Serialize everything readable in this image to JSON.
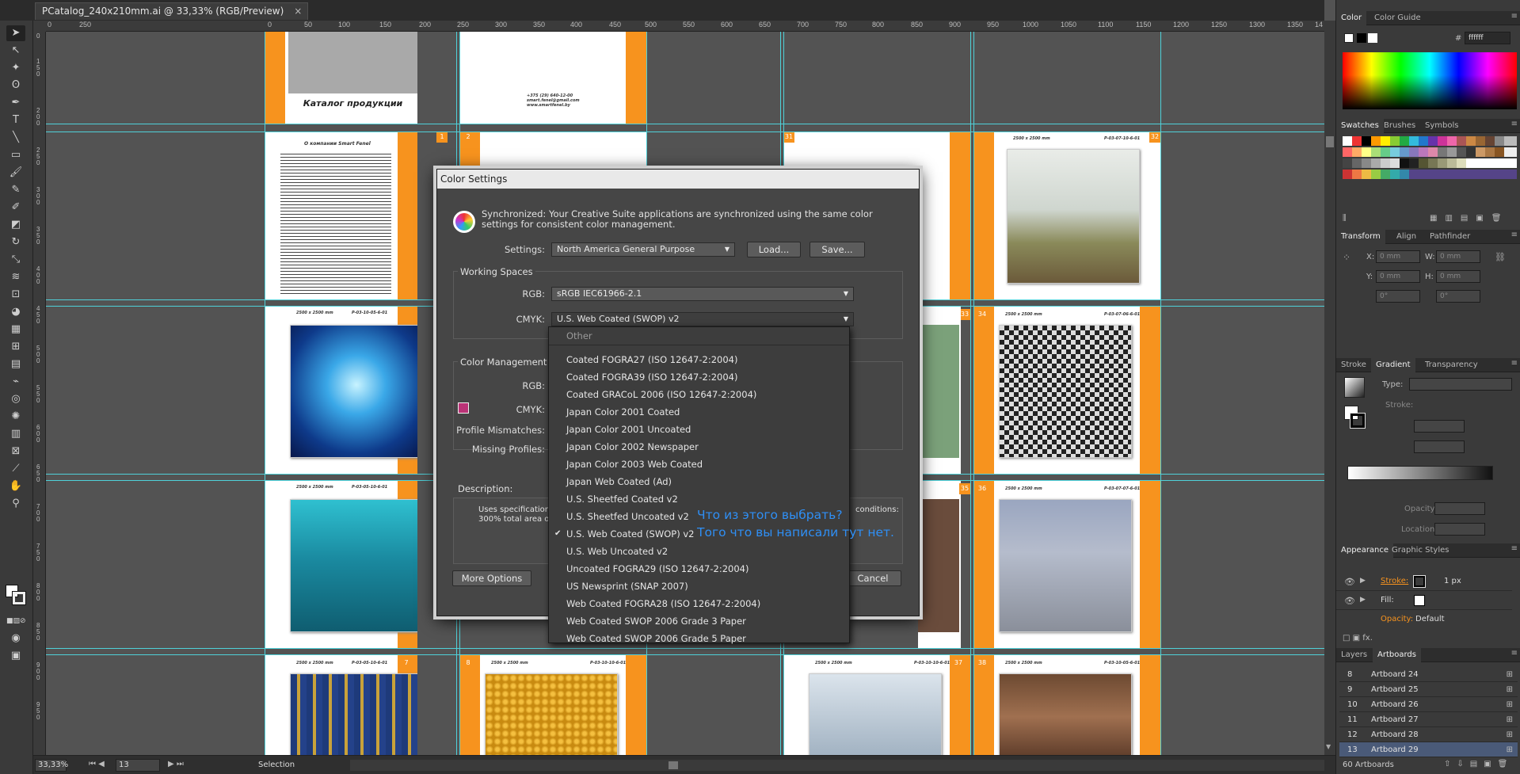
{
  "document": {
    "tab_title": "PCatalog_240x210mm.ai @ 33,33% (RGB/Preview)",
    "close_glyph": "×"
  },
  "ruler": {
    "top_ticks": [
      "0",
      "250",
      "0",
      "50",
      "100",
      "150",
      "200",
      "250",
      "300",
      "350",
      "400",
      "450",
      "500",
      "550",
      "600",
      "650",
      "700",
      "750",
      "800",
      "850",
      "900",
      "950",
      "1000",
      "1050",
      "1100",
      "1150",
      "1200",
      "1250",
      "1300",
      "1350",
      "14"
    ],
    "left_ticks": [
      "0",
      "150",
      "200",
      "250",
      "300",
      "350",
      "400",
      "450",
      "500",
      "550",
      "600",
      "650",
      "700",
      "750",
      "800",
      "850",
      "900",
      "950"
    ]
  },
  "artboards": {
    "catalog_title": "Каталог продукции",
    "contact_lines": [
      "+375 (29) 640-12-00",
      "smart.fenel@gmail.com",
      "www.smartfenel.by"
    ],
    "about_title": "О компании Smart Fenel",
    "page_numbers": [
      "1",
      "2",
      "31",
      "32",
      "33",
      "34",
      "35",
      "36",
      "7",
      "8",
      "37",
      "38"
    ],
    "size_captions": [
      "2500 x 2500 mm",
      "P-03-07-10-6-01",
      "2500 x 2500 mm",
      "P-03-10-05-6-01",
      "2500 x 2500 mm",
      "P-03-07-06-6-01",
      "2500 x 2500 mm",
      "P-03-05-10-6-01",
      "2500 x 2500 mm",
      "P-03-07-07-6-01",
      "2500 x 2500 mm",
      "P-03-05-10-6-01",
      "2500 x 2500 mm",
      "P-03-10-10-6-01",
      "2500 x 2500 mm",
      "P-03-10-10-6-01",
      "2500 x 2500 mm",
      "P-03-10-05-6-01",
      "2500 x 2500 mm",
      "P-03-10-05-6-01"
    ]
  },
  "statusbar": {
    "zoom": "33,33%",
    "artboard_num": "13",
    "tool": "Selection"
  },
  "dialog": {
    "title": "Color Settings",
    "sync_text": "Synchronized: Your Creative Suite applications are synchronized using the same color settings for consistent color management.",
    "settings_label": "Settings:",
    "settings_value": "North America General Purpose",
    "load_button": "Load...",
    "save_button": "Save...",
    "working_spaces": "Working Spaces",
    "rgb_label": "RGB:",
    "rgb_value": "sRGB IEC61966-2.1",
    "cmyk_label": "CMYK:",
    "cmyk_value": "U.S. Web Coated (SWOP) v2",
    "cmp_group": "Color Management P",
    "cmp_rgb_label": "RGB:",
    "cmp_cmyk_label": "CMYK:",
    "profile_mismatches": "Profile Mismatches:",
    "missing_profiles": "Missing Profiles:",
    "description_label": "Description:",
    "description_text_1": "Uses specifications",
    "description_text_2": "300% total area of i",
    "description_right": "conditions:",
    "more_options": "More Options",
    "cancel_button": "Cancel"
  },
  "dropdown": {
    "header": "Other",
    "items": [
      "Coated FOGRA27 (ISO 12647-2:2004)",
      "Coated FOGRA39 (ISO 12647-2:2004)",
      "Coated GRACoL 2006 (ISO 12647-2:2004)",
      "Japan Color 2001 Coated",
      "Japan Color 2001 Uncoated",
      "Japan Color 2002 Newspaper",
      "Japan Color 2003 Web Coated",
      "Japan Web Coated (Ad)",
      "U.S. Sheetfed Coated v2",
      "U.S. Sheetfed Uncoated v2",
      "U.S. Web Coated (SWOP) v2",
      "U.S. Web Uncoated v2",
      "Uncoated FOGRA29 (ISO 12647-2:2004)",
      "US Newsprint (SNAP 2007)",
      "Web Coated FOGRA28 (ISO 12647-2:2004)",
      "Web Coated SWOP 2006 Grade 3 Paper",
      "Web Coated SWOP 2006 Grade 5 Paper"
    ],
    "checked_index": 10,
    "check_glyph": "✔"
  },
  "overlay_text": {
    "line1": "Что из этого выбрать?",
    "line2": "Того что вы написали тут нет."
  },
  "panels": {
    "color_tabs": [
      "Color",
      "Color Guide"
    ],
    "hex_symbol": "#",
    "hex_value": "ffffff",
    "swatch_tabs": [
      "Swatches",
      "Brushes",
      "Symbols"
    ],
    "transform_tabs": [
      "Transform",
      "Align",
      "Pathfinder"
    ],
    "transform_labels": [
      "X:",
      "W:",
      "Y:",
      "H:"
    ],
    "transform_values": [
      "0 mm",
      "0 mm",
      "0 mm",
      "0 mm"
    ],
    "transform_angles": [
      "0°",
      "0°"
    ],
    "gradient_tabs": [
      "Stroke",
      "Gradient",
      "Transparency"
    ],
    "gradient_type_label": "Type:",
    "gradient_stroke_label": "Stroke:",
    "opacity_label": "Opacity:",
    "location_label": "Location:",
    "appearance_tabs": [
      "Appearance",
      "Graphic Styles"
    ],
    "appearance_rows": [
      {
        "label": "Stroke:",
        "value": "1 px"
      },
      {
        "label": "Fill:",
        "value": ""
      },
      {
        "label": "Opacity:",
        "value": "Default"
      }
    ],
    "appearance_fx": "fx.",
    "layers_tabs": [
      "Layers",
      "Artboards"
    ],
    "artboard_rows": [
      {
        "num": "8",
        "name": "Artboard 24"
      },
      {
        "num": "9",
        "name": "Artboard 25"
      },
      {
        "num": "10",
        "name": "Artboard 26"
      },
      {
        "num": "11",
        "name": "Artboard 27"
      },
      {
        "num": "12",
        "name": "Artboard 28"
      },
      {
        "num": "13",
        "name": "Artboard 29"
      }
    ],
    "artboards_count": "60 Artboards"
  },
  "colors": {
    "accent_orange": "#f7931e",
    "guide_cyan": "#4fd1d9",
    "overlay_blue": "#2f8ff5",
    "selected_row": "#4a5a78"
  }
}
